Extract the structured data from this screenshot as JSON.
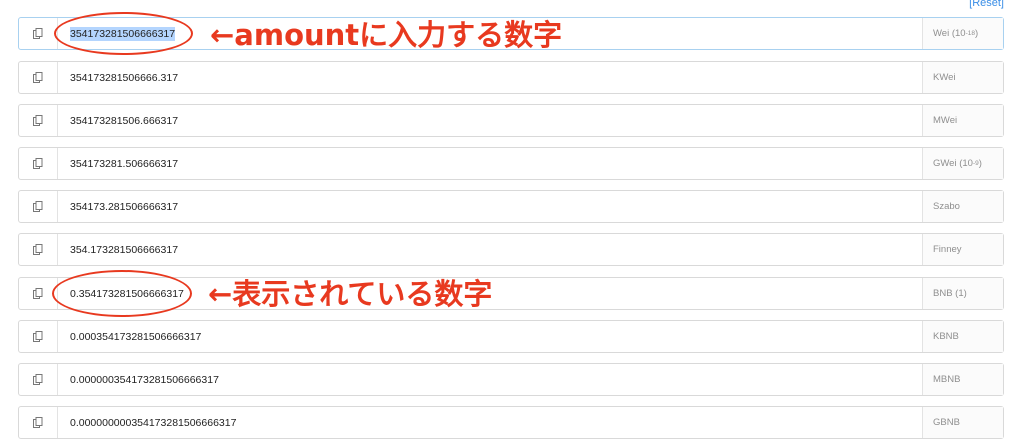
{
  "reset_label": "[Reset]",
  "rows": [
    {
      "value": "354173281506666317",
      "unit": "Wei",
      "unit_exp": "-18"
    },
    {
      "value": "354173281506666.317",
      "unit": "KWei"
    },
    {
      "value": "354173281506.666317",
      "unit": "MWei"
    },
    {
      "value": "354173281.506666317",
      "unit": "GWei",
      "unit_exp": "-9"
    },
    {
      "value": "354173.281506666317",
      "unit": "Szabo"
    },
    {
      "value": "354.173281506666317",
      "unit": "Finney"
    },
    {
      "value": "0.354173281506666317",
      "unit": "BNB (1)"
    },
    {
      "value": "0.000354173281506666317",
      "unit": "KBNB"
    },
    {
      "value": "0.000000354173281506666317",
      "unit": "MBNB"
    },
    {
      "value": "0.000000000354173281506666317",
      "unit": "GBNB"
    }
  ],
  "annotations": {
    "amount_label": "←amountに入力する数字",
    "displayed_label": "←表示されている数字"
  },
  "colors": {
    "annotation": "#e8391f",
    "selection": "#b4d5fe",
    "link": "#3a8ee6"
  },
  "icons": {
    "copy": "copy-icon"
  }
}
